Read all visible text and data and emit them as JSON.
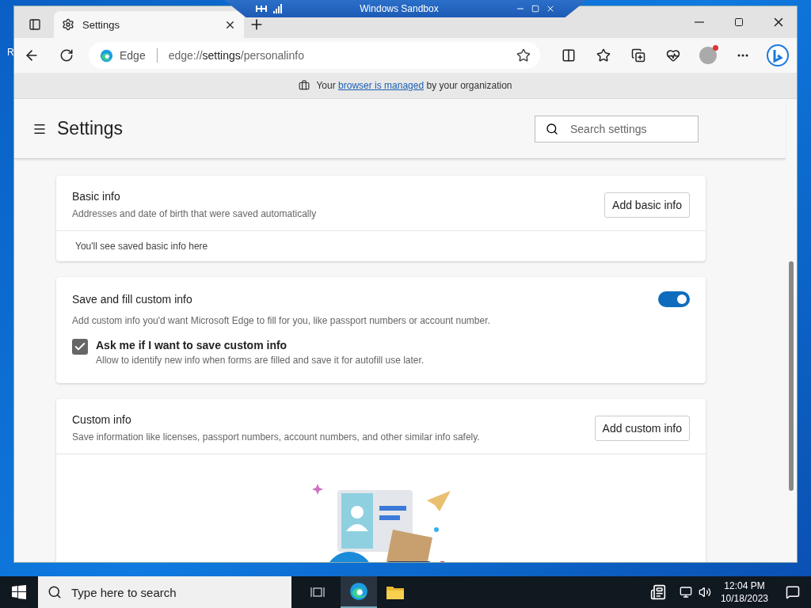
{
  "sandbox": {
    "title": "Windows Sandbox"
  },
  "desktop": {
    "label": "R"
  },
  "browser": {
    "tabs": [
      {
        "title": "Settings",
        "selected": true
      }
    ],
    "address": {
      "site": "Edge",
      "url_prefix": "edge://",
      "url_host": "settings",
      "url_path": "/personalinfo"
    },
    "managed_notice": {
      "before": "Your",
      "link": "browser is managed",
      "after": "by your organization"
    }
  },
  "settings": {
    "title": "Settings",
    "search": {
      "placeholder": "Search settings"
    },
    "cards": [
      {
        "kind": "list",
        "title": "Basic info",
        "description": "Addresses and date of birth that were saved automatically",
        "button": "Add basic info",
        "empty_text": "You'll see saved basic info here"
      },
      {
        "kind": "toggle",
        "title": "Save and fill custom info",
        "on": true,
        "description": "Add custom info you'd want Microsoft Edge to fill for you, like passport numbers or account number.",
        "option": {
          "label": "Ask me if I want to save custom info",
          "hint": "Allow to identify new info when forms are filled and save it for autofill use later.",
          "checked": true
        }
      },
      {
        "kind": "list",
        "title": "Custom info",
        "description": "Save information like licenses, passport numbers, account numbers, and other similar info safely.",
        "button": "Add custom info",
        "illustration": true
      }
    ]
  },
  "taskbar": {
    "search_placeholder": "Type here to search",
    "time": "12:04 PM",
    "date": "10/18/2023"
  }
}
